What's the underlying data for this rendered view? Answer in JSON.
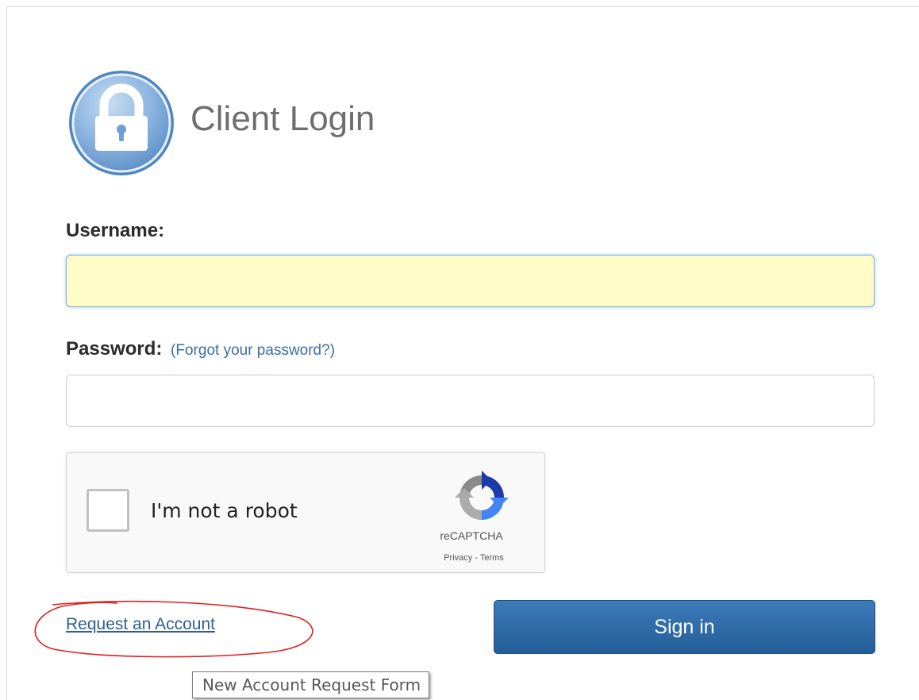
{
  "header": {
    "title": "Client Login",
    "icon": "lock-icon"
  },
  "form": {
    "username_label": "Username:",
    "username_value": "",
    "password_label": "Password:",
    "forgot_password_link": "(Forgot your password?)",
    "password_value": ""
  },
  "recaptcha": {
    "label": "I'm not a robot",
    "brand": "reCAPTCHA",
    "privacy_link": "Privacy",
    "separator": " - ",
    "terms_link": "Terms",
    "checked": false
  },
  "actions": {
    "request_account_link": "Request an Account",
    "sign_in_label": "Sign in"
  },
  "tooltip": {
    "text": "New Account Request Form"
  },
  "colors": {
    "username_bg": "#fffcc8",
    "button_bg": "#2b6aa8",
    "link": "#2f5f93",
    "annotation": "#e02020"
  }
}
